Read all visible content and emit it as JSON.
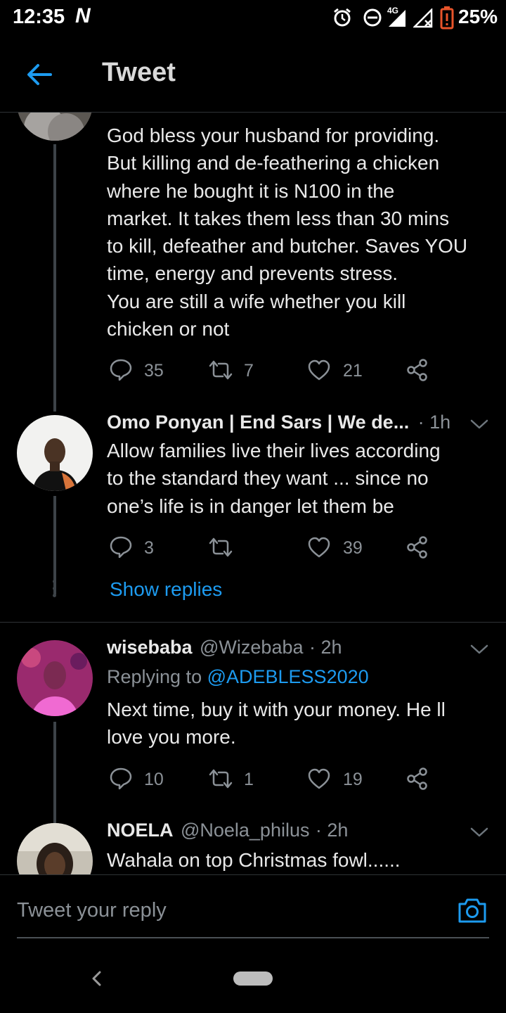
{
  "status_bar": {
    "time": "12:35",
    "carrier_icon": "N",
    "network": "4G",
    "battery": "25%"
  },
  "header": {
    "title": "Tweet",
    "back_icon": "arrow-left-icon"
  },
  "tweets": [
    {
      "text_lines": [
        "God bless your husband for providing.",
        "But killing and de-feathering a chicken",
        "where he bought it is N100 in the",
        "market. It takes them less than 30 mins",
        "to kill, defeather and butcher. Saves YOU",
        "time, energy and prevents stress.",
        "You are still a wife whether you kill",
        "chicken or not"
      ],
      "replies": "35",
      "retweets": "7",
      "likes": "21"
    },
    {
      "name": "Omo Ponyan | End Sars | We de...",
      "time": "· 1h",
      "text_lines": [
        "Allow families live their lives according",
        "to the standard they want ... since no",
        "one’s life is in danger let them be"
      ],
      "replies": "3",
      "retweets": "",
      "likes": "39",
      "show_replies": "Show replies"
    },
    {
      "name": "wisebaba",
      "handle": "@Wizebaba",
      "time": "· 2h",
      "replying_prefix": "Replying to ",
      "replying_to": "@ADEBLESS2020",
      "text_lines": [
        "Next time, buy it with your money. He ll",
        "love you more."
      ],
      "replies": "10",
      "retweets": "1",
      "likes": "19"
    },
    {
      "name": "NOELA",
      "handle": "@Noela_philus",
      "time": "· 2h",
      "text_lines": [
        "Wahala on top Christmas fowl......"
      ]
    }
  ],
  "reply_bar": {
    "placeholder": "Tweet your reply",
    "camera_icon": "camera-icon"
  },
  "colors": {
    "accent": "#1d9bf0",
    "background": "#000000",
    "muted": "#8b9197",
    "battery_low": "#e8542a"
  }
}
